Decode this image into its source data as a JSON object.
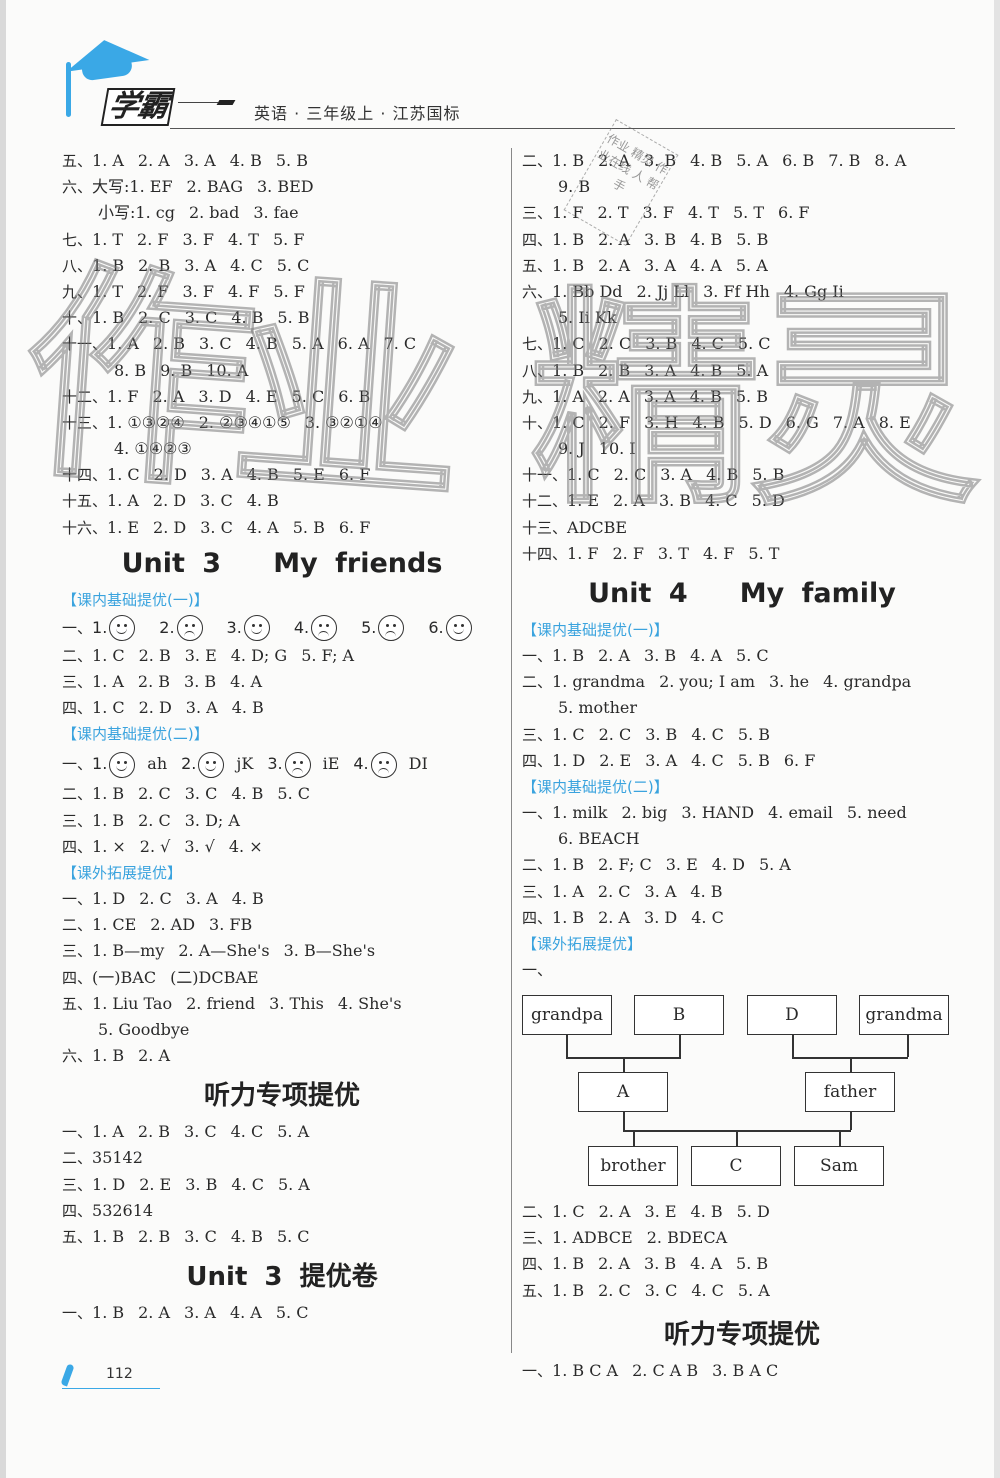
{
  "header": {
    "logo_text": "学霸",
    "book_title": "英语 · 三年级上 · 江苏国标"
  },
  "left_column": {
    "prev_unit_lines": [
      {
        "q": "五、",
        "items": [
          "1. A",
          "2. A",
          "3. A",
          "4. B",
          "5. B"
        ]
      },
      {
        "q": "六、",
        "items": [
          "大写:1. EF",
          "2. BAG",
          "3. BED"
        ]
      },
      {
        "q": "",
        "indent": true,
        "items": [
          "小写:1. cg",
          "2. bad",
          "3. fae"
        ]
      },
      {
        "q": "七、",
        "items": [
          "1. T",
          "2. F",
          "3. F",
          "4. T",
          "5. F"
        ]
      },
      {
        "q": "八、",
        "items": [
          "1. B",
          "2. B",
          "3. A",
          "4. C",
          "5. C"
        ]
      },
      {
        "q": "九、",
        "items": [
          "1. T",
          "2. F",
          "3. F",
          "4. F",
          "5. F"
        ]
      },
      {
        "q": "十、",
        "items": [
          "1. B",
          "2. C",
          "3. C",
          "4. B",
          "5. B"
        ]
      },
      {
        "q": "十一、",
        "items": [
          "1. A",
          "2. B",
          "3. C",
          "4. B",
          "5. A",
          "6. A",
          "7. C"
        ]
      },
      {
        "q": "",
        "indent2": true,
        "items": [
          "8. B",
          "9. B",
          "10. A"
        ]
      },
      {
        "q": "十二、",
        "items": [
          "1. F",
          "2. A",
          "3. D",
          "4. E",
          "5. C",
          "6. B"
        ]
      },
      {
        "q": "十三、",
        "items": [
          "1. ①③②④",
          "2. ②③④①⑤",
          "3. ③②①④"
        ]
      },
      {
        "q": "",
        "indent2": true,
        "items": [
          "4. ①④②③"
        ]
      },
      {
        "q": "十四、",
        "items": [
          "1. C",
          "2. D",
          "3. A",
          "4. B",
          "5. E",
          "6. F"
        ]
      },
      {
        "q": "十五、",
        "items": [
          "1. A",
          "2. D",
          "3. C",
          "4. B"
        ]
      },
      {
        "q": "十六、",
        "items": [
          "1. E",
          "2. D",
          "3. C",
          "4. A",
          "5. B",
          "6. F"
        ]
      }
    ],
    "unit3_title": "Unit 3   My friends",
    "unit3_sec1_tag": "【课内基础提优(一)】",
    "unit3_sec1_faces": [
      {
        "n": "1.",
        "face": "smile"
      },
      {
        "n": "2.",
        "face": "sad"
      },
      {
        "n": "3.",
        "face": "smile"
      },
      {
        "n": "4.",
        "face": "sad"
      },
      {
        "n": "5.",
        "face": "sad"
      },
      {
        "n": "6.",
        "face": "smile"
      }
    ],
    "unit3_sec1_face_q": "一、",
    "unit3_sec1_lines": [
      {
        "q": "二、",
        "items": [
          "1. C",
          "2. B",
          "3. E",
          "4. D; G",
          "5. F; A"
        ]
      },
      {
        "q": "三、",
        "items": [
          "1. A",
          "2. B",
          "3. B",
          "4. A"
        ]
      },
      {
        "q": "四、",
        "items": [
          "1. C",
          "2. D",
          "3. A",
          "4. B"
        ]
      }
    ],
    "unit3_sec2_tag": "【课内基础提优(二)】",
    "unit3_sec2_face_q": "一、",
    "unit3_sec2_faces": [
      {
        "n": "1.",
        "face": "smile",
        "text": "ah"
      },
      {
        "n": "2.",
        "face": "smile",
        "text": "jK"
      },
      {
        "n": "3.",
        "face": "sad",
        "text": "iE"
      },
      {
        "n": "4.",
        "face": "sad",
        "text": "DI"
      }
    ],
    "unit3_sec2_lines": [
      {
        "q": "二、",
        "items": [
          "1. B",
          "2. C",
          "3. C",
          "4. B",
          "5. C"
        ]
      },
      {
        "q": "三、",
        "items": [
          "1. B",
          "2. C",
          "3. D; A"
        ]
      },
      {
        "q": "四、",
        "items": [
          "1. ×",
          "2. √",
          "3. √",
          "4. ×"
        ]
      }
    ],
    "unit3_sec3_tag": "【课外拓展提优】",
    "unit3_sec3_lines": [
      {
        "q": "一、",
        "items": [
          "1. D",
          "2. C",
          "3. A",
          "4. B"
        ]
      },
      {
        "q": "二、",
        "items": [
          "1. CE",
          "2. AD",
          "3. FB"
        ]
      },
      {
        "q": "三、",
        "items": [
          "1. B—my",
          "2. A—She's",
          "3. B—She's"
        ]
      },
      {
        "q": "四、",
        "items": [
          "(一)BAC",
          "(二)DCBAE"
        ]
      },
      {
        "q": "五、",
        "items": [
          "1. Liu Tao",
          "2. friend",
          "3. This",
          "4. She's"
        ]
      },
      {
        "q": "",
        "indent": true,
        "items": [
          "5. Goodbye"
        ]
      },
      {
        "q": "六、",
        "items": [
          "1. B",
          "2. A"
        ]
      }
    ],
    "listening_title": "听力专项提优",
    "listening_lines": [
      {
        "q": "一、",
        "items": [
          "1. A",
          "2. B",
          "3. C",
          "4. C",
          "5. A"
        ]
      },
      {
        "q": "二、",
        "items": [
          "35142"
        ]
      },
      {
        "q": "三、",
        "items": [
          "1. D",
          "2. E",
          "3. B",
          "4. C",
          "5. A"
        ]
      },
      {
        "q": "四、",
        "items": [
          "532614"
        ]
      },
      {
        "q": "五、",
        "items": [
          "1. B",
          "2. B",
          "3. C",
          "4. B",
          "5. C"
        ]
      }
    ],
    "unit3_test_title": "Unit 3 提优卷",
    "unit3_test_lines": [
      {
        "q": "一、",
        "items": [
          "1. B",
          "2. A",
          "3. A",
          "4. A",
          "5. C"
        ]
      }
    ]
  },
  "right_column": {
    "prev_unit_lines": [
      {
        "q": "二、",
        "items": [
          "1. B",
          "2. A",
          "3. B",
          "4. B",
          "5. A",
          "6. B",
          "7. B",
          "8. A"
        ]
      },
      {
        "q": "",
        "indent": true,
        "items": [
          "9. B"
        ]
      },
      {
        "q": "三、",
        "items": [
          "1. F",
          "2. T",
          "3. F",
          "4. T",
          "5. T",
          "6. F"
        ]
      },
      {
        "q": "四、",
        "items": [
          "1. B",
          "2. A",
          "3. B",
          "4. B",
          "5. B"
        ]
      },
      {
        "q": "五、",
        "items": [
          "1. B",
          "2. A",
          "3. A",
          "4. A",
          "5. A"
        ]
      },
      {
        "q": "六、",
        "items": [
          "1. Bb  Dd",
          "2. Jj  Ll",
          "3. Ff  Hh",
          "4. Gg  Ii"
        ]
      },
      {
        "q": "",
        "indent": true,
        "items": [
          "5. Ii  Kk"
        ]
      },
      {
        "q": "七、",
        "items": [
          "1. C",
          "2. C",
          "3. B",
          "4. C",
          "5. C"
        ]
      },
      {
        "q": "八、",
        "items": [
          "1. B",
          "2. B",
          "3. A",
          "4. B",
          "5. A"
        ]
      },
      {
        "q": "九、",
        "items": [
          "1. A",
          "2. A",
          "3. A",
          "4. B",
          "5. B"
        ]
      },
      {
        "q": "十、",
        "items": [
          "1. C",
          "2. F",
          "3. H",
          "4. B",
          "5. D",
          "6. G",
          "7. A",
          "8. E"
        ]
      },
      {
        "q": "",
        "indent": true,
        "items": [
          "9. J",
          "10. I"
        ]
      },
      {
        "q": "十一、",
        "items": [
          "1. C",
          "2. C",
          "3. A",
          "4. B",
          "5. B"
        ]
      },
      {
        "q": "十二、",
        "items": [
          "1. E",
          "2. A",
          "3. B",
          "4. C",
          "5. D"
        ]
      },
      {
        "q": "十三、",
        "items": [
          "ADCBE"
        ]
      },
      {
        "q": "十四、",
        "items": [
          "1. F",
          "2. F",
          "3. T",
          "4. F",
          "5. T"
        ]
      }
    ],
    "unit4_title": "Unit 4   My family",
    "unit4_sec1_tag": "【课内基础提优(一)】",
    "unit4_sec1_lines": [
      {
        "q": "一、",
        "items": [
          "1. B",
          "2. A",
          "3. B",
          "4. A",
          "5. C"
        ]
      },
      {
        "q": "二、",
        "items": [
          "1. grandma",
          "2. you; I am",
          "3. he",
          "4. grandpa"
        ]
      },
      {
        "q": "",
        "indent": true,
        "items": [
          "5. mother"
        ]
      },
      {
        "q": "三、",
        "items": [
          "1. C",
          "2. C",
          "3. B",
          "4. C",
          "5. B"
        ]
      },
      {
        "q": "四、",
        "items": [
          "1. D",
          "2. E",
          "3. A",
          "4. C",
          "5. B",
          "6. F"
        ]
      }
    ],
    "unit4_sec2_tag": "【课内基础提优(二)】",
    "unit4_sec2_lines": [
      {
        "q": "一、",
        "items": [
          "1. milk",
          "2. big",
          "3. HAND",
          "4. email",
          "5. need"
        ]
      },
      {
        "q": "",
        "indent": true,
        "items": [
          "6. BEACH"
        ]
      },
      {
        "q": "二、",
        "items": [
          "1. B",
          "2. F; C",
          "3. E",
          "4. D",
          "5. A"
        ]
      },
      {
        "q": "三、",
        "items": [
          "1. A",
          "2. C",
          "3. A",
          "4. B"
        ]
      },
      {
        "q": "四、",
        "items": [
          "1. B",
          "2. A",
          "3. D",
          "4. C"
        ]
      }
    ],
    "unit4_sec3_tag": "【课外拓展提优】",
    "unit4_sec3_tree_q": "一、",
    "family_tree": {
      "grandpa": "grandpa",
      "b": "B",
      "d": "D",
      "grandma": "grandma",
      "a": "A",
      "father": "father",
      "brother": "brother",
      "c": "C",
      "sam": "Sam"
    },
    "unit4_sec3_lines": [
      {
        "q": "二、",
        "items": [
          "1. C",
          "2. A",
          "3. E",
          "4. B",
          "5. D"
        ]
      },
      {
        "q": "三、",
        "items": [
          "1. ADBCE",
          "2. BDECA"
        ]
      },
      {
        "q": "四、",
        "items": [
          "1. B",
          "2. A",
          "3. B",
          "4. A",
          "5. B"
        ]
      },
      {
        "q": "五、",
        "items": [
          "1. B",
          "2. C",
          "3. C",
          "4. C",
          "5. A"
        ]
      }
    ],
    "listening_title": "听力专项提优",
    "listening_lines": [
      {
        "q": "一、",
        "items": [
          "1. B  C  A",
          "2. C  A  B",
          "3. B  A  C"
        ]
      }
    ]
  },
  "footer": {
    "page_number": "112"
  },
  "watermark": {
    "left": "作业",
    "right": "精灵",
    "stamp": "作业 精灵 作业在线 人 帮手"
  },
  "colors": {
    "accent": "#3aa3de",
    "text": "#2a2a2a"
  }
}
